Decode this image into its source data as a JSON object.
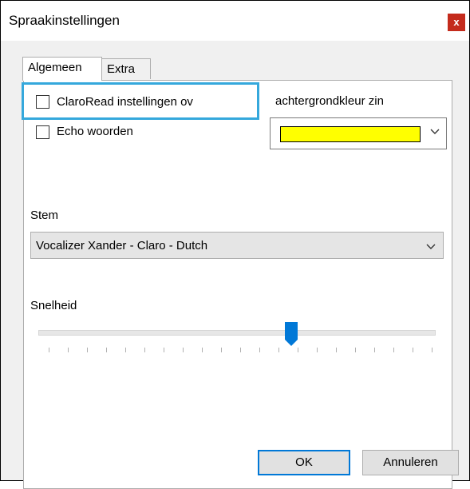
{
  "window": {
    "title": "Spraakinstellingen",
    "close_label": "x"
  },
  "tabs": [
    {
      "label": "Algemeen",
      "active": true
    },
    {
      "label": "Extra",
      "active": false
    }
  ],
  "general": {
    "claroread_checkbox_label": "ClaroRead instellingen ov",
    "echo_checkbox_label": "Echo woorden",
    "background_label": "achtergrondkleur zin",
    "background_color": "#ffff00",
    "voice_label": "Stem",
    "voice_value": "Vocalizer Xander - Claro - Dutch",
    "speed_label": "Snelheid",
    "speed_fraction": 0.64
  },
  "buttons": {
    "ok": "OK",
    "cancel": "Annuleren"
  },
  "colors": {
    "accent": "#0078d7",
    "focus": "#35a8dc",
    "close": "#c42b1c"
  }
}
